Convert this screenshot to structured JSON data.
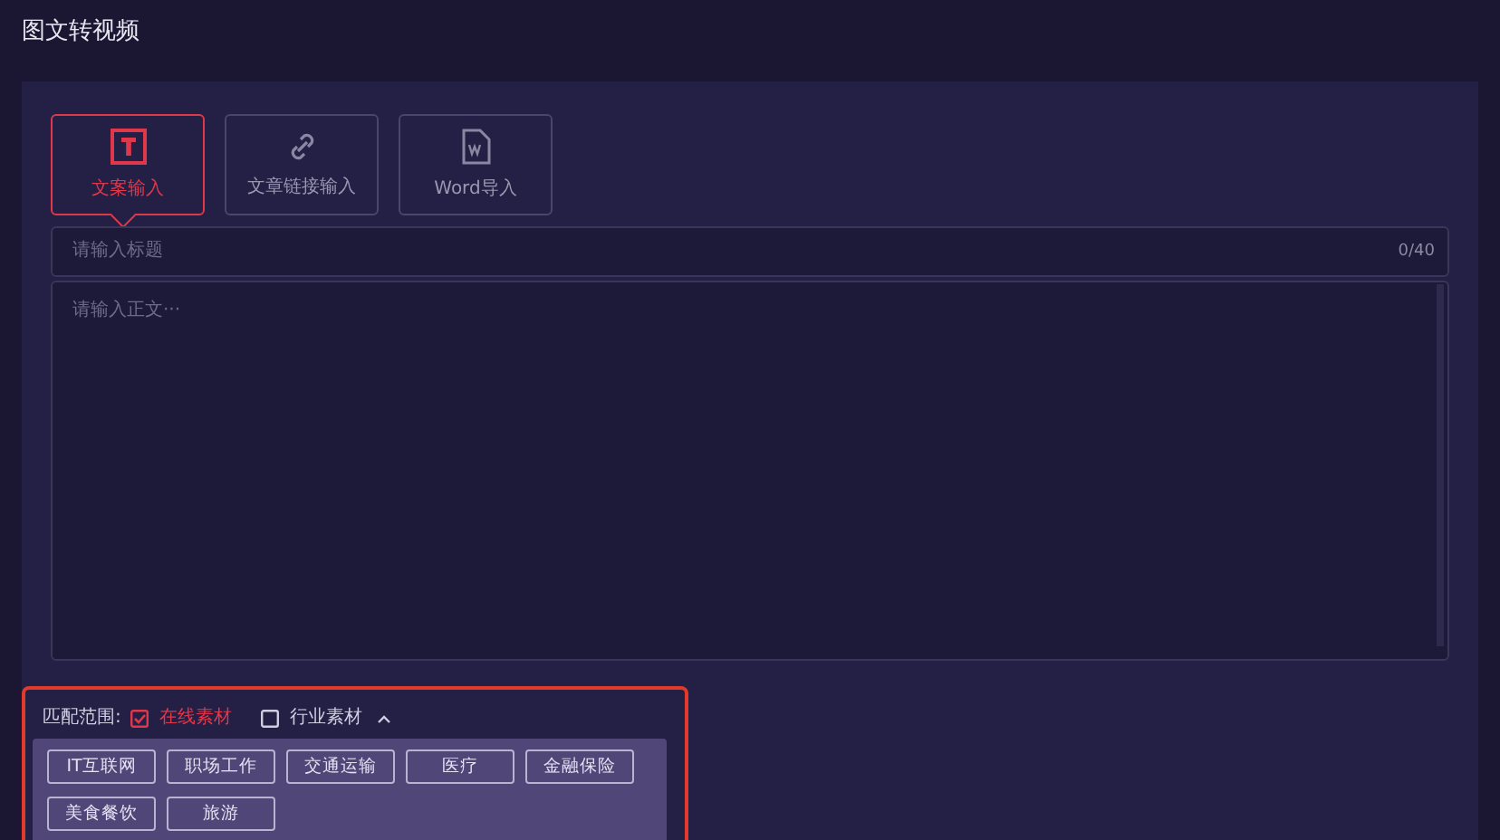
{
  "window": {
    "title": "图文转视频"
  },
  "tabs": [
    {
      "label": "文案输入",
      "kind": "text",
      "selected": true
    },
    {
      "label": "文章链接输入",
      "kind": "link",
      "selected": false
    },
    {
      "label": "Word导入",
      "kind": "document",
      "selected": false
    }
  ],
  "title_field": {
    "placeholder": "请输入标题",
    "counter": "0/40"
  },
  "body_field": {
    "placeholder": "请输入正文···"
  },
  "match_scope": {
    "label": "匹配范围:",
    "options": [
      {
        "label": "在线素材",
        "checked": true
      },
      {
        "label": "行业素材",
        "checked": false,
        "expanded": true
      }
    ]
  },
  "industries": [
    "IT互联网",
    "职场工作",
    "交通运输",
    "医疗",
    "金融保险",
    "美食餐饮",
    "旅游"
  ]
}
